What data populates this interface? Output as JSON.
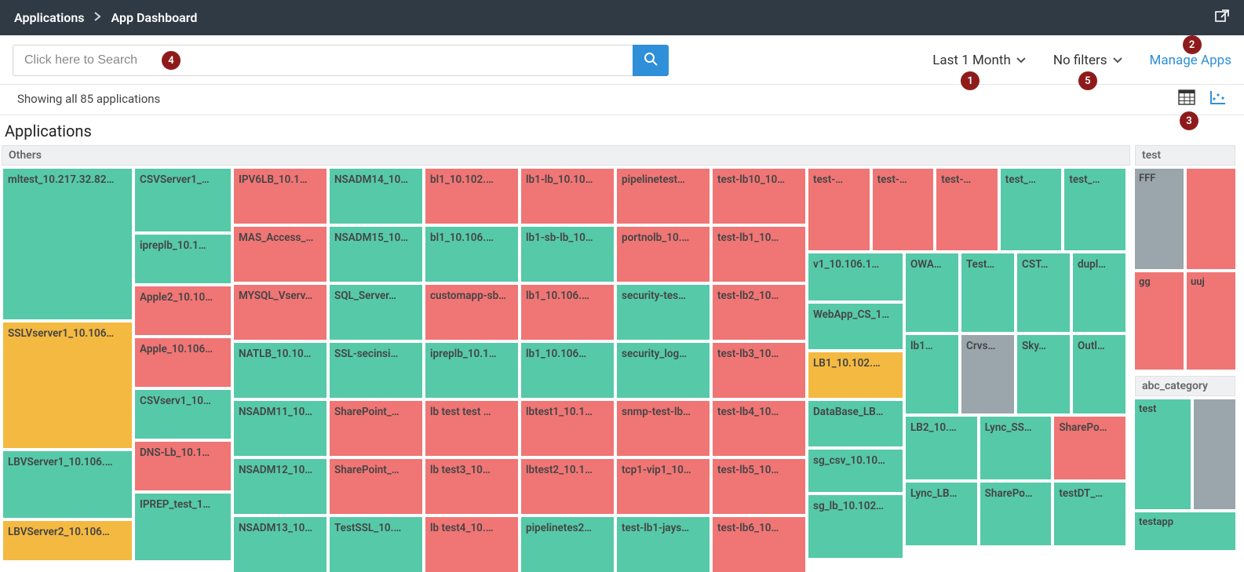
{
  "breadcrumb": {
    "root": "Applications",
    "current": "App Dashboard"
  },
  "search": {
    "placeholder": "Click here to Search"
  },
  "toolbar": {
    "time_range": "Last 1 Month",
    "filter_label": "No filters",
    "manage": "Manage Apps"
  },
  "status": {
    "text": "Showing all 85 applications"
  },
  "section": {
    "title": "Applications"
  },
  "badges": {
    "b1": "1",
    "b2": "2",
    "b3": "3",
    "b4": "4",
    "b5": "5"
  },
  "groups": {
    "others_label": "Others",
    "test_label": "test",
    "abc_label": "abc_category"
  },
  "treemap": {
    "col0": {
      "c0": "mltest_10.217.32.82…",
      "c1": "SSLVserver1_10.106…",
      "c2": "LBVServer1_10.106.…",
      "c3": "LBVServer2_10.106…"
    },
    "col1": {
      "r0": "CSVServer1_…",
      "r1": "ipreplb_10.1…",
      "r2": "Apple2_10.10…",
      "r3": "Apple_10.106…",
      "r4": "CSVserv1_10…",
      "r5": "DNS-Lb_10.1…",
      "r6": "IPREP_test_1…"
    },
    "col2": {
      "r0": "IPV6LB_10.1…",
      "r1": "MAS_Access_…",
      "r2": "MYSQL_Vserv…",
      "r3": "NATLB_10.10…",
      "r4": "NSADM11_10…",
      "r5": "NSADM12_10…",
      "r6": "NSADM13_10…"
    },
    "col3": {
      "r0": "NSADM14_10…",
      "r1": "NSADM15_10…",
      "r2": "SQL_Server…",
      "r3": "SSL-secinsi…",
      "r4": "SharePoint_…",
      "r5": "SharePoint_…",
      "r6": "TestSSL_10.…"
    },
    "col4": {
      "r0": "bl1_10.102.…",
      "r1": "bl1_10.106.…",
      "r2": "customapp-sb…",
      "r3": "ipreplb_10.1…",
      "r4": "lb test test …",
      "r5": "lb test3_10…",
      "r6": "lb test4_10.…"
    },
    "col5": {
      "r0": "lb1-lb_10.10…",
      "r1": "lb1-sb-lb_10…",
      "r2": "lb1_10.106.…",
      "r3": "lb1_10.106…",
      "r4": "lbtest1_10.1…",
      "r5": "lbtest2_10.1…",
      "r6": "pipelinetes2…"
    },
    "col6": {
      "r0": "pipelinetest…",
      "r1": "portnolb_10.…",
      "r2": "security-tes…",
      "r3": "security_log…",
      "r4": "snmp-test-lb…",
      "r5": "tcp1-vip1_10…",
      "r6": "test-lb1-jays…"
    },
    "col7": {
      "r0": "test-lb10_10…",
      "r1": "test-lb1_10…",
      "r2": "test-lb2_10…",
      "r3": "test-lb3_10…",
      "r4": "test-lb4_10…",
      "r5": "test-lb5_10…",
      "r6": "test-lb6_10…"
    },
    "col8top": {
      "r0a": "test-…",
      "r0b": "test-…",
      "r0c": "test-…",
      "r0d": "test_…",
      "r0e": "test_…"
    },
    "col8midL": {
      "r0": "v1_10.106.1…",
      "r1": "WebApp_CS_1…",
      "r2": "LB1_10.102.…",
      "r3": "DataBase_LB…",
      "r4": "sg_csv_10.10…",
      "r5": "sg_lb_10.102…"
    },
    "col8midR_row1": {
      "a": "OWA…",
      "b": "Test…",
      "c": "CST…",
      "d": "dupl…"
    },
    "col8midR_row2": {
      "a": "lb1…",
      "b": "Crvs…",
      "c": "Sky…",
      "d": "Outl…"
    },
    "col8midR_row3": {
      "a": "LB2_10.…",
      "b": "Lync_SS…",
      "c": "SharePo…"
    },
    "col8midR_row4": {
      "a": "Lync_LB…",
      "b": "SharePo…",
      "c": "testDT_…"
    }
  },
  "side": {
    "test": {
      "r0a": "FFF",
      "r0b": "",
      "r1a": "gg",
      "r1b": "uuj"
    },
    "abc": {
      "r0a": "test",
      "r0b": "",
      "r1": "testapp"
    }
  }
}
